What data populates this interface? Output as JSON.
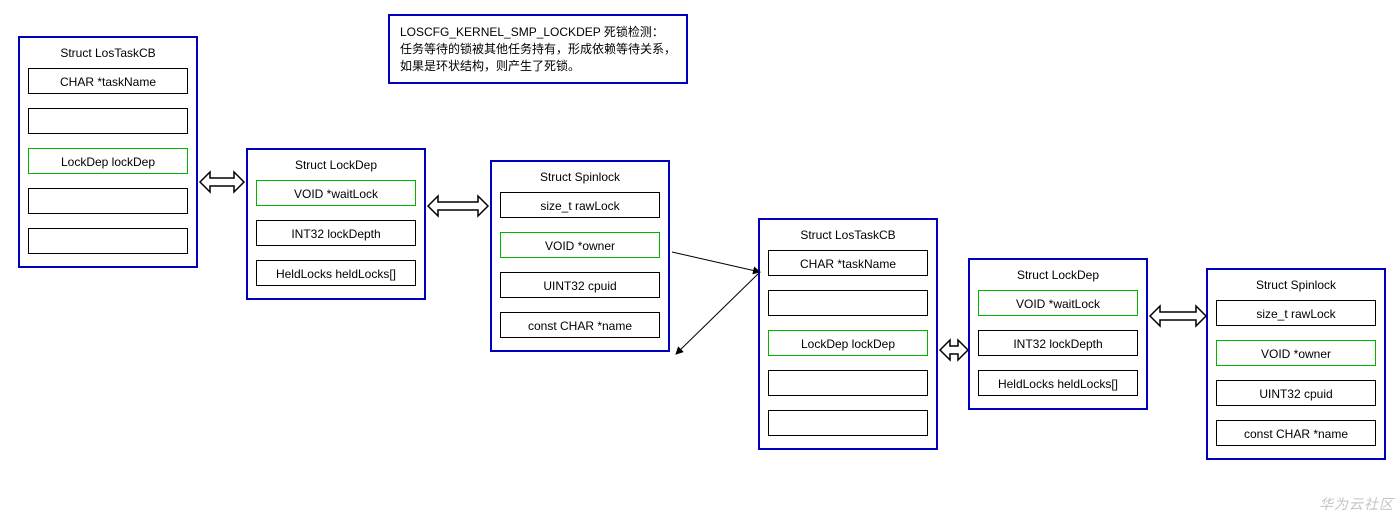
{
  "note": {
    "line1": "LOSCFG_KERNEL_SMP_LOCKDEP 死锁检测：",
    "line2": "任务等待的锁被其他任务持有，形成依赖等待关系，如果是环状结构，则产生了死锁。"
  },
  "box1": {
    "title": "Struct LosTaskCB",
    "f1": "CHAR *taskName",
    "f2": "",
    "f3": "LockDep lockDep",
    "f4": "",
    "f5": ""
  },
  "box2": {
    "title": "Struct LockDep",
    "f1": "VOID *waitLock",
    "f2": "INT32 lockDepth",
    "f3": "HeldLocks heldLocks[]"
  },
  "box3": {
    "title": "Struct Spinlock",
    "f1": "size_t rawLock",
    "f2": "VOID *owner",
    "f3": "UINT32 cpuid",
    "f4": "const CHAR *name"
  },
  "box4": {
    "title": "Struct LosTaskCB",
    "f1": "CHAR *taskName",
    "f2": "",
    "f3": "LockDep lockDep",
    "f4": "",
    "f5": ""
  },
  "box5": {
    "title": "Struct LockDep",
    "f1": "VOID *waitLock",
    "f2": "INT32 lockDepth",
    "f3": "HeldLocks heldLocks[]"
  },
  "box6": {
    "title": "Struct Spinlock",
    "f1": "size_t rawLock",
    "f2": "VOID *owner",
    "f3": "UINT32 cpuid",
    "f4": "const CHAR *name"
  },
  "watermark": "华为云社区"
}
